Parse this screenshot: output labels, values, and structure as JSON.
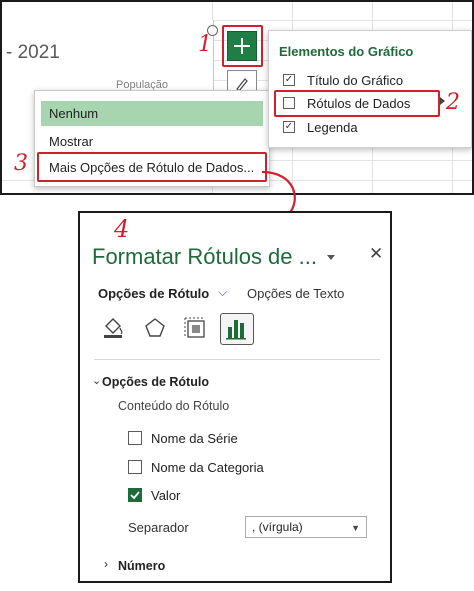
{
  "chart": {
    "title_fragment": "- 2021",
    "series_text": "População"
  },
  "elements_pane": {
    "title": "Elementos do Gráfico",
    "items": [
      {
        "label": "Título do Gráfico",
        "checked": true
      },
      {
        "label": "Rótulos de Dados",
        "checked": false
      },
      {
        "label": "Legenda",
        "checked": true
      }
    ]
  },
  "options_menu": {
    "items": [
      {
        "label": "Nenhum",
        "highlighted": true
      },
      {
        "label": "Mostrar",
        "highlighted": false
      },
      {
        "label": "Mais Opções de Rótulo de Dados...",
        "highlighted": false
      }
    ]
  },
  "annotations": {
    "step1": "1",
    "step2": "2",
    "step3": "3",
    "step4": "4",
    "color": "#d0202b"
  },
  "format_pane": {
    "title": "Formatar Rótulos de ...",
    "tabs": {
      "label_options": "Opções de Rótulo",
      "text_options": "Opções de Texto"
    },
    "icons": [
      "fill-line-icon",
      "effects-icon",
      "size-properties-icon",
      "label-options-icon"
    ],
    "section": "Opções de Rótulo",
    "content_label": "Conteúdo do Rótulo",
    "options": [
      {
        "label": "Nome da Série",
        "checked": false
      },
      {
        "label": "Nome da Categoria",
        "checked": false
      },
      {
        "label": "Valor",
        "checked": true
      }
    ],
    "separator_label": "Separador",
    "separator_value": ", (vírgula)",
    "number_section": "Número"
  },
  "colors": {
    "excel_green": "#1e6b3a",
    "menu_highlight": "#a6d5b0",
    "annotation_red": "#d0202b"
  }
}
